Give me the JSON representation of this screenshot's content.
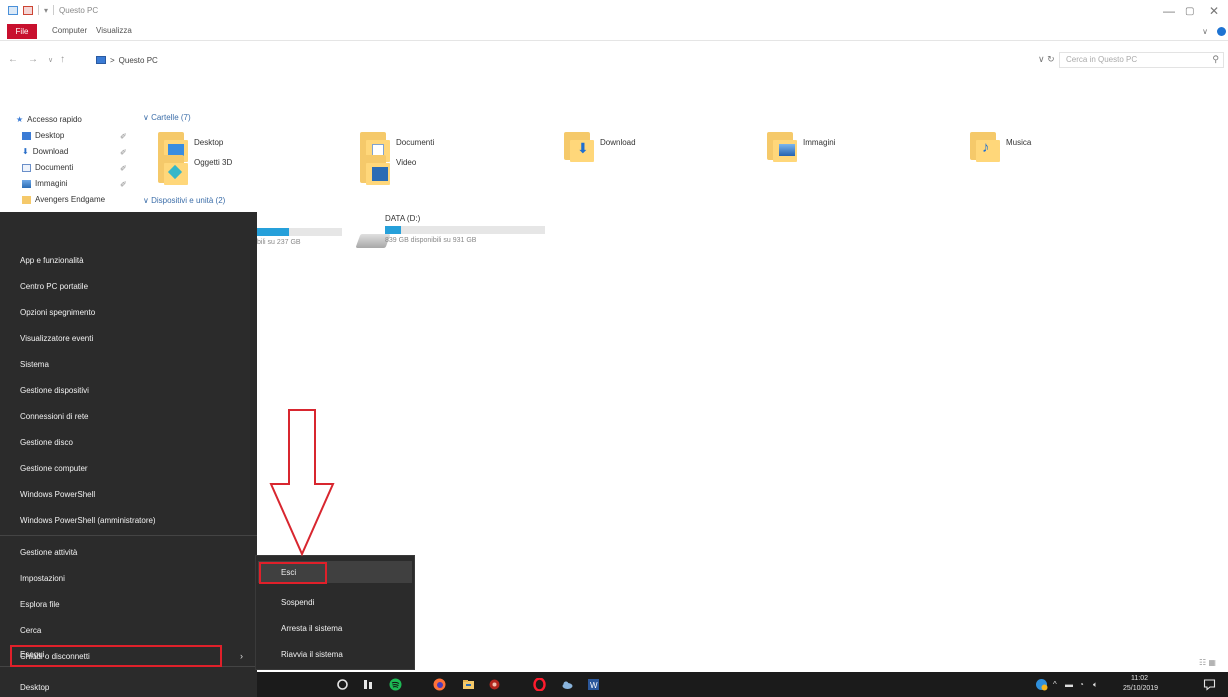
{
  "window": {
    "title": "Questo PC",
    "controls": {
      "minimize": "—",
      "maximize": "▢",
      "close": "✕"
    }
  },
  "ribbon": {
    "tabs": [
      {
        "label": "File",
        "active": true
      },
      {
        "label": "Computer"
      },
      {
        "label": "Visualizza"
      }
    ]
  },
  "addressbar": {
    "path": [
      "Questo PC"
    ],
    "separator": ">",
    "search_placeholder": "Cerca in Questo PC"
  },
  "navpane": {
    "quick_access_label": "Accesso rapido",
    "items": [
      {
        "label": "Desktop",
        "icon": "desktop-icon",
        "pinned": true
      },
      {
        "label": "Download",
        "icon": "download-icon",
        "pinned": true
      },
      {
        "label": "Documenti",
        "icon": "documents-icon",
        "pinned": true
      },
      {
        "label": "Immagini",
        "icon": "pictures-icon",
        "pinned": true
      },
      {
        "label": "Avengers Endgame",
        "icon": "folder-icon",
        "pinned": false
      }
    ]
  },
  "content": {
    "folders_header": "Cartelle (7)",
    "folders": [
      {
        "label": "Desktop",
        "icon": "desktop-folder-icon"
      },
      {
        "label": "Documenti",
        "icon": "documents-folder-icon"
      },
      {
        "label": "Download",
        "icon": "download-folder-icon"
      },
      {
        "label": "Immagini",
        "icon": "pictures-folder-icon"
      },
      {
        "label": "Musica",
        "icon": "music-folder-icon"
      },
      {
        "label": "Oggetti 3D",
        "icon": "3d-objects-folder-icon"
      },
      {
        "label": "Video",
        "icon": "video-folder-icon"
      }
    ],
    "drives_header": "Dispositivi e unità (2)",
    "drives": [
      {
        "label": "",
        "free_text": "bili su 237 GB",
        "used_fraction": 0.38
      },
      {
        "label": "DATA (D:)",
        "free_text": "839 GB disponibili su 931 GB",
        "used_fraction": 0.1
      }
    ]
  },
  "winx_menu": {
    "items": [
      "App e funzionalità",
      "Centro PC portatile",
      "Opzioni spegnimento",
      "Visualizzatore eventi",
      "Sistema",
      "Gestione dispositivi",
      "Connessioni di rete",
      "Gestione disco",
      "Gestione computer",
      "Windows PowerShell",
      "Windows PowerShell (amministratore)",
      "Gestione attività",
      "Impostazioni",
      "Esplora file",
      "Cerca",
      "Esegui",
      "Chiudi o disconnetti",
      "Desktop"
    ],
    "arrow": "›"
  },
  "submenu": {
    "items": [
      "Esci",
      "Sospendi",
      "Arresta il sistema",
      "Riavvia il sistema"
    ]
  },
  "taskbar": {
    "time": "11:02",
    "date": "25/10/2019",
    "icons": [
      "cortana-icon",
      "task-view-icon",
      "spotify-icon",
      "firefox-icon",
      "file-explorer-icon",
      "game-icon",
      "opera-icon",
      "cloud-icon",
      "word-icon"
    ]
  },
  "colors": {
    "accent_red": "#e0202a",
    "menu_bg": "#2b2b2b",
    "taskbar_bg": "#1b1b1b",
    "drive_fill": "#26a0da",
    "folder_yellow": "#ffd77a"
  }
}
